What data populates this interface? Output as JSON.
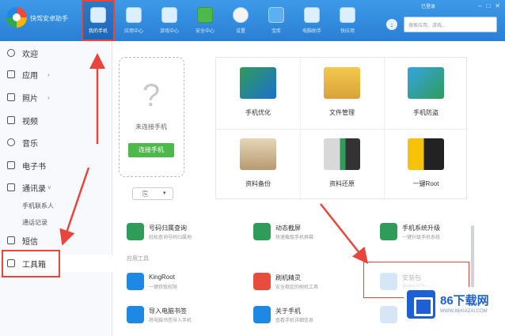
{
  "app": {
    "title": "快驾安卓助手",
    "login": "已登录",
    "window_controls": [
      "–",
      "□",
      "✕"
    ]
  },
  "nav": {
    "items": [
      {
        "label": "我的手机",
        "icon": "phone-icon"
      },
      {
        "label": "应用中心",
        "icon": "apps-icon"
      },
      {
        "label": "游戏中心",
        "icon": "game-icon"
      },
      {
        "label": "安全中心",
        "icon": "lock-icon"
      },
      {
        "label": "设置",
        "icon": "clock-icon"
      },
      {
        "label": "宝库",
        "icon": "box-icon"
      },
      {
        "label": "电脑助手",
        "icon": "monitor-icon"
      },
      {
        "label": "快应用",
        "icon": "window-icon"
      }
    ]
  },
  "search": {
    "placeholder": "搜索应用、游戏..."
  },
  "sidebar": {
    "items": [
      {
        "label": "欢迎"
      },
      {
        "label": "应用",
        "chevron": "›"
      },
      {
        "label": "照片",
        "chevron": "›"
      },
      {
        "label": "视频"
      },
      {
        "label": "音乐"
      },
      {
        "label": "电子书"
      },
      {
        "label": "通讯录",
        "chevron": "˅"
      },
      {
        "label": "短信"
      },
      {
        "label": "工具箱"
      }
    ],
    "subitems": [
      "手机联系人",
      "通话记录"
    ]
  },
  "device": {
    "placeholder_glyph": "?",
    "status": "未连接手机",
    "connect_label": "连接手机",
    "screenshot_glyph": "⎘",
    "dropdown_glyph": "▾"
  },
  "tools": {
    "tiles": [
      {
        "label": "手机优化"
      },
      {
        "label": "文件管理"
      },
      {
        "label": "手机防盗"
      },
      {
        "label": "资料备份"
      },
      {
        "label": "资料还原"
      },
      {
        "label": "一键Root"
      }
    ],
    "rows": [
      {
        "name": "号码归属查询",
        "desc": "轻松查询号码归属地"
      },
      {
        "name": "动态截屏",
        "desc": "快速截取手机屏幕"
      },
      {
        "name": "手机系统升级",
        "desc": "一键升级手机系统"
      }
    ],
    "section_label": "应用工具",
    "app_rows": [
      {
        "name": "KingRoot",
        "desc": "一键获取权限"
      },
      {
        "name": "刷机精灵",
        "desc": "安全稳定的刷机工具"
      },
      {
        "name": "导入电脑书签",
        "desc": "将电脑书签导入手机"
      },
      {
        "name": "关于手机",
        "desc": "查看手机详细信息"
      }
    ],
    "faded_row": {
      "name": "安装包",
      "desc": "管理安装包"
    }
  },
  "watermark": {
    "brand": "86下载网",
    "url": "WWW.86XIAZAI.COM"
  },
  "colors": {
    "topbar": "#2a7fd4",
    "accent_red": "#e8463c",
    "connect_green": "#4cb94a",
    "brand_blue": "#1e5fd6"
  }
}
